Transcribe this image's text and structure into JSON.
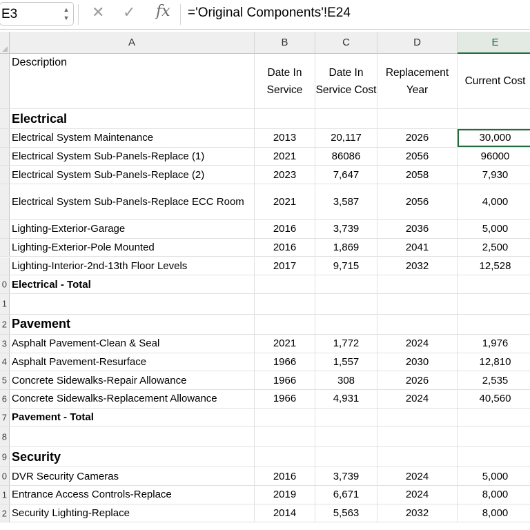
{
  "formula_bar": {
    "name_box": "E3",
    "formula": "='Original Components'!E24",
    "fx_label": "fx"
  },
  "columns": [
    "A",
    "B",
    "C",
    "D",
    "E"
  ],
  "header": {
    "description": "Description",
    "date_in_service": "Date In Service",
    "date_in_service_cost": "Date In Service Cost",
    "replacement_year": "Replacement Year",
    "current_cost": "Current Cost"
  },
  "rows": [
    {
      "num": "",
      "type": "section",
      "desc": "Electrical"
    },
    {
      "num": "",
      "type": "data",
      "desc": "Electrical System Maintenance",
      "b": "2013",
      "c": "20,117",
      "d": "2026",
      "e": "30,000",
      "selected": true
    },
    {
      "num": "",
      "type": "data",
      "desc": "Electrical System Sub-Panels-Replace (1)",
      "b": "2021",
      "c": "86086",
      "d": "2056",
      "e": "96000"
    },
    {
      "num": "",
      "type": "data",
      "desc": "Electrical System Sub-Panels-Replace (2)",
      "b": "2023",
      "c": "7,647",
      "d": "2058",
      "e": "7,930"
    },
    {
      "num": "",
      "type": "tall",
      "desc": "Electrical System Sub-Panels-Replace ECC Room",
      "b": "2021",
      "c": "3,587",
      "d": "2056",
      "e": "4,000"
    },
    {
      "num": "",
      "type": "data",
      "desc": "Lighting-Exterior-Garage",
      "b": "2016",
      "c": "3,739",
      "d": "2036",
      "e": "5,000"
    },
    {
      "num": "",
      "type": "data",
      "desc": "Lighting-Exterior-Pole Mounted",
      "b": "2016",
      "c": "1,869",
      "d": "2041",
      "e": "2,500"
    },
    {
      "num": "",
      "type": "data",
      "desc": "Lighting-Interior-2nd-13th Floor Levels",
      "b": "2017",
      "c": "9,715",
      "d": "2032",
      "e": "12,528"
    },
    {
      "num": "0",
      "type": "total",
      "desc": "Electrical - Total"
    },
    {
      "num": "1",
      "type": "blank",
      "desc": ""
    },
    {
      "num": "2",
      "type": "section",
      "desc": "Pavement"
    },
    {
      "num": "3",
      "type": "data",
      "desc": "Asphalt Pavement-Clean & Seal",
      "b": "2021",
      "c": "1,772",
      "d": "2024",
      "e": "1,976"
    },
    {
      "num": "4",
      "type": "data",
      "desc": "Asphalt Pavement-Resurface",
      "b": "1966",
      "c": "1,557",
      "d": "2030",
      "e": "12,810"
    },
    {
      "num": "5",
      "type": "data",
      "desc": "Concrete Sidewalks-Repair Allowance",
      "b": "1966",
      "c": "308",
      "d": "2026",
      "e": "2,535"
    },
    {
      "num": "6",
      "type": "data",
      "desc": "Concrete Sidewalks-Replacement Allowance",
      "b": "1966",
      "c": "4,931",
      "d": "2024",
      "e": "40,560"
    },
    {
      "num": "7",
      "type": "total",
      "desc": "Pavement - Total"
    },
    {
      "num": "8",
      "type": "blank",
      "desc": ""
    },
    {
      "num": "9",
      "type": "section",
      "desc": "Security"
    },
    {
      "num": "0",
      "type": "data",
      "desc": "DVR Security Cameras",
      "b": "2016",
      "c": "3,739",
      "d": "2024",
      "e": "5,000"
    },
    {
      "num": "1",
      "type": "data",
      "desc": "Entrance Access Controls-Replace",
      "b": "2019",
      "c": "6,671",
      "d": "2024",
      "e": "8,000"
    },
    {
      "num": "2",
      "type": "data",
      "desc": "Security Lighting-Replace",
      "b": "2014",
      "c": "5,563",
      "d": "2032",
      "e": "8,000"
    }
  ]
}
